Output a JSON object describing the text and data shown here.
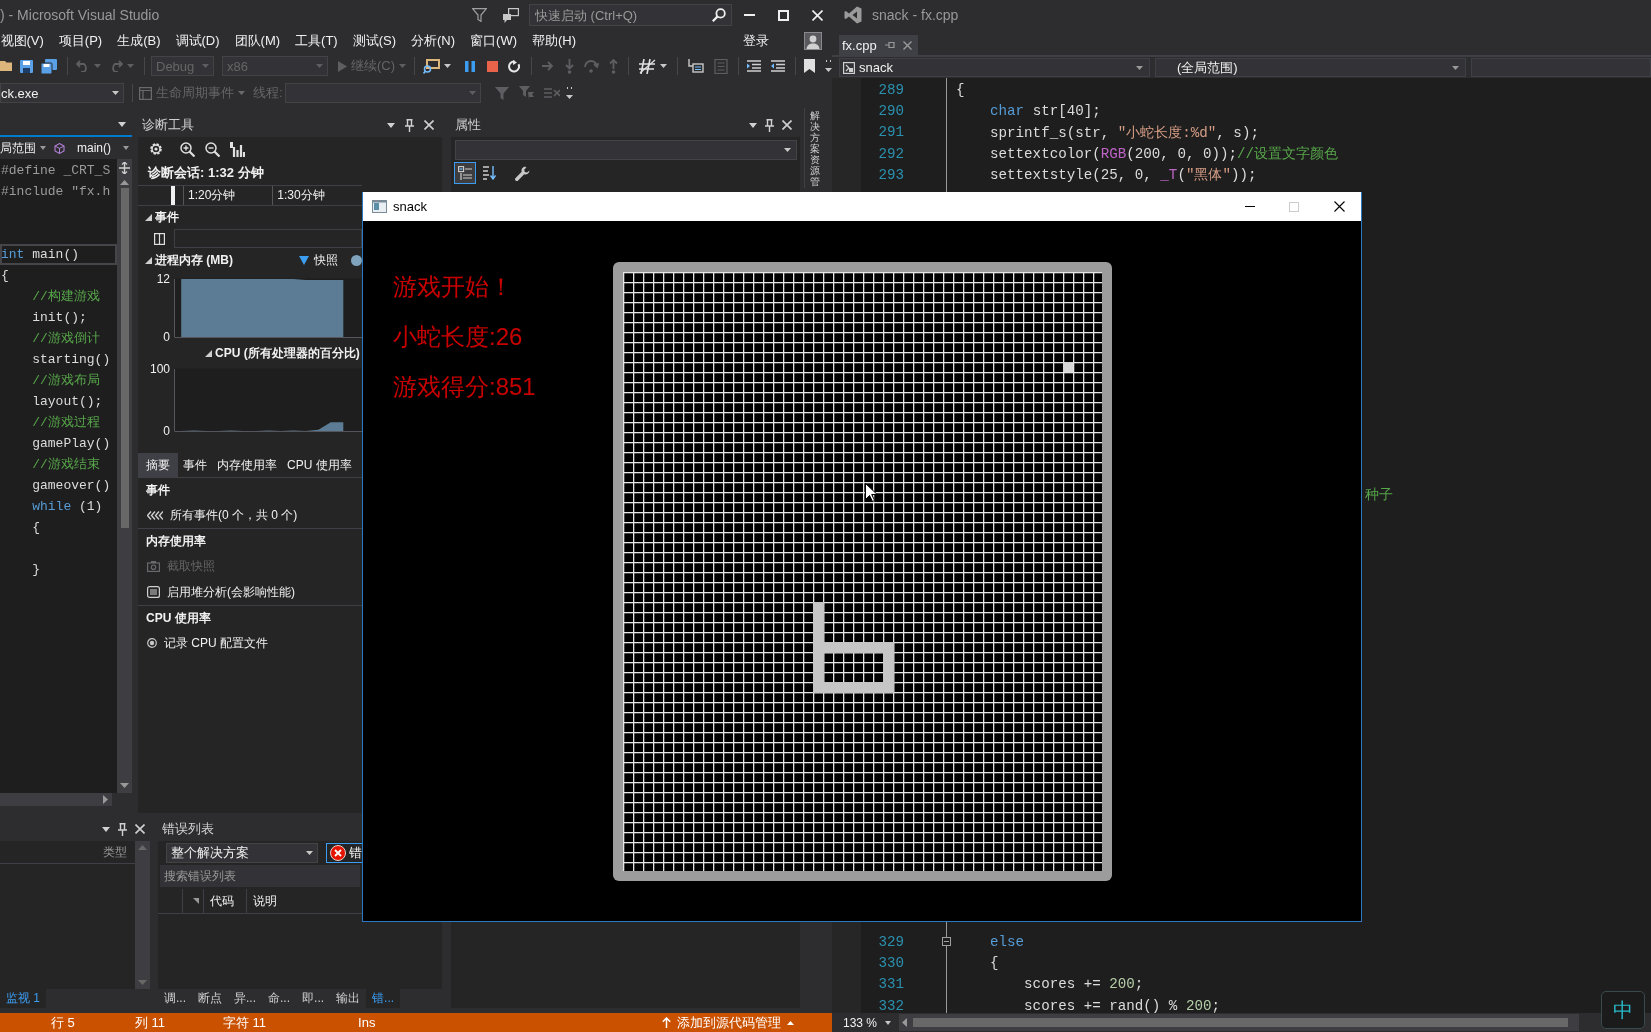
{
  "left_window": {
    "title": ") - Microsoft Visual Studio",
    "quick_launch": {
      "placeholder": "快速启动 (Ctrl+Q)"
    },
    "menu": [
      "视图(V)",
      "项目(P)",
      "生成(B)",
      "调试(D)",
      "团队(M)",
      "工具(T)",
      "测试(S)",
      "分析(N)",
      "窗口(W)",
      "帮助(H)"
    ],
    "sign_in": "登录",
    "toolbar": {
      "configuration": {
        "value": "Debug",
        "disabled": true
      },
      "platform": {
        "value": "x86",
        "disabled": true
      },
      "continue_button": {
        "label": "继续(C)",
        "disabled": true
      }
    },
    "debug_location": {
      "process": "ck.exe",
      "lifecycle_events": {
        "label": "生命周期事件",
        "disabled": true
      },
      "thread": {
        "label": "线程:",
        "disabled": true
      }
    },
    "code_editor": {
      "scope": "局范围",
      "member": "main()",
      "blocks": [
        [
          {
            "current": false,
            "tokens": [
              {
                "kind": "preprocessor",
                "text": "#define _CRT_S"
              }
            ]
          },
          {
            "current": false,
            "tokens": [
              {
                "kind": "preprocessor",
                "text": "#include \"fx.h"
              }
            ]
          }
        ],
        [
          {
            "current": true,
            "tokens": [
              {
                "kind": "keyword",
                "text": "int"
              },
              {
                "kind": "plain",
                "text": " main()"
              }
            ]
          },
          {
            "current": false,
            "tokens": [
              {
                "kind": "plain",
                "text": "{"
              }
            ]
          },
          {
            "current": false,
            "tokens": [
              {
                "kind": "comment",
                "text": "    //构建游戏"
              }
            ]
          },
          {
            "current": false,
            "tokens": [
              {
                "kind": "plain",
                "text": "    init();"
              }
            ]
          },
          {
            "current": false,
            "tokens": [
              {
                "kind": "comment",
                "text": "    //游戏倒计"
              }
            ]
          },
          {
            "current": false,
            "tokens": [
              {
                "kind": "plain",
                "text": "    starting()"
              }
            ]
          },
          {
            "current": false,
            "tokens": [
              {
                "kind": "comment",
                "text": "    //游戏布局"
              }
            ]
          },
          {
            "current": false,
            "tokens": [
              {
                "kind": "plain",
                "text": "    layout();"
              }
            ]
          },
          {
            "current": false,
            "tokens": [
              {
                "kind": "comment",
                "text": "    //游戏过程"
              }
            ]
          },
          {
            "current": false,
            "tokens": [
              {
                "kind": "plain",
                "text": "    gamePlay()"
              }
            ]
          },
          {
            "current": false,
            "tokens": [
              {
                "kind": "comment",
                "text": "    //游戏结束"
              }
            ]
          },
          {
            "current": false,
            "tokens": [
              {
                "kind": "plain",
                "text": "    gameover()"
              }
            ]
          },
          {
            "current": false,
            "tokens": [
              {
                "kind": "keyword",
                "text": "    while"
              },
              {
                "kind": "plain",
                "text": " (1)"
              }
            ]
          },
          {
            "current": false,
            "tokens": [
              {
                "kind": "plain",
                "text": "    {"
              }
            ]
          }
        ],
        [
          {
            "current": false,
            "tokens": [
              {
                "kind": "plain",
                "text": "    }"
              }
            ]
          }
        ]
      ]
    },
    "diagnostic_tools": {
      "title": "诊断工具",
      "session": "诊断会话: 1:32 分钟",
      "timeline": [
        "1:20分钟",
        "1:30分钟"
      ],
      "events_section": {
        "title": "事件",
        "expanded": true
      },
      "memory_section": {
        "title": "进程内存 (MB)",
        "expanded": true,
        "legend": "快照",
        "chart_data": {
          "type": "area",
          "categories": [
            null,
            null,
            null,
            null,
            null,
            null,
            null,
            null,
            null,
            null,
            null,
            null,
            null,
            null,
            null
          ],
          "yticks": [
            0,
            12
          ],
          "ylim": [
            0,
            12
          ],
          "values": [
            12,
            12,
            12,
            12,
            12,
            12,
            12,
            12,
            12,
            12,
            11.8,
            11.8,
            11.8,
            11.8,
            null
          ]
        }
      },
      "cpu_section": {
        "title": "CPU (所有处理器的百分比)",
        "expanded": true,
        "chart_data": {
          "type": "area",
          "categories": [
            null,
            null,
            null,
            null,
            null,
            null,
            null,
            null,
            null,
            null,
            null,
            null,
            null,
            null,
            null
          ],
          "yticks": [
            0,
            100
          ],
          "ylim": [
            0,
            100
          ],
          "values": [
            0,
            1,
            0,
            0,
            1,
            0,
            0,
            1,
            0,
            1,
            0,
            2,
            14,
            14,
            null
          ]
        }
      },
      "tabs": [
        {
          "label": "摘要",
          "selected": true
        },
        {
          "label": "事件",
          "selected": false
        },
        {
          "label": "内存使用率",
          "selected": false
        },
        {
          "label": "CPU 使用率",
          "selected": false
        }
      ],
      "summary": [
        {
          "title": "事件",
          "items": [
            {
              "kind": "events",
              "label": "所有事件(0 个，共 0 个)",
              "disabled": false
            }
          ]
        },
        {
          "title": "内存使用率",
          "items": [
            {
              "kind": "snapshot",
              "label": "截取快照",
              "disabled": true
            },
            {
              "kind": "heap",
              "label": "启用堆分析(会影响性能)",
              "disabled": false
            }
          ]
        },
        {
          "title": "CPU 使用率",
          "items": [
            {
              "kind": "record",
              "label": "记录 CPU 配置文件",
              "disabled": false
            }
          ]
        }
      ]
    },
    "properties": {
      "title": "属性",
      "view_buttons": [
        {
          "selected": true
        },
        {
          "selected": false
        }
      ]
    },
    "side_tab": "解决方案资源管",
    "watch": {
      "column": "类型",
      "tabs": [
        {
          "label": "监视 1",
          "selected": true
        }
      ]
    },
    "error_list": {
      "title": "错误列表",
      "scope": "整个解决方案",
      "errors_button": "错",
      "search": {
        "placeholder": "搜索错误列表"
      },
      "columns": [
        "代码",
        "说明"
      ],
      "tabs": [
        {
          "label": "调...",
          "selected": false
        },
        {
          "label": "断点",
          "selected": false
        },
        {
          "label": "异...",
          "selected": false
        },
        {
          "label": "命...",
          "selected": false
        },
        {
          "label": "即...",
          "selected": false
        },
        {
          "label": "输出",
          "selected": false
        },
        {
          "label": "错...",
          "selected": true
        }
      ]
    },
    "status_bar": {
      "line": "行 5",
      "column": "列 11",
      "character": "字符 11",
      "mode": "Ins",
      "source_control": "添加到源代码管理"
    }
  },
  "right_window": {
    "title": "snack - fx.cpp",
    "tabs": [
      {
        "label": "fx.cpp",
        "selected": true
      }
    ],
    "project": "snack",
    "scope": "(全局范围)",
    "code_top": [
      {
        "number": "289",
        "fold_marker": false,
        "tokens": [
          {
            "kind": "plain",
            "text": "{"
          }
        ]
      },
      {
        "number": "290",
        "fold_marker": false,
        "tokens": [
          {
            "kind": "keyword",
            "text": "    char"
          },
          {
            "kind": "plain",
            "text": " str[40];"
          }
        ]
      },
      {
        "number": "291",
        "fold_marker": false,
        "tokens": [
          {
            "kind": "plain",
            "text": "    sprintf_s(str, "
          },
          {
            "kind": "string",
            "text": "\"小蛇长度:%d\""
          },
          {
            "kind": "plain",
            "text": ", s);"
          }
        ]
      },
      {
        "number": "292",
        "fold_marker": false,
        "tokens": [
          {
            "kind": "plain",
            "text": "    settextcolor("
          },
          {
            "kind": "macro",
            "text": "RGB"
          },
          {
            "kind": "plain",
            "text": "(200, 0, 0));"
          },
          {
            "kind": "comment",
            "text": "//设置文字颜色"
          }
        ]
      },
      {
        "number": "293",
        "fold_marker": false,
        "tokens": [
          {
            "kind": "plain",
            "text": "    settextstyle(25, 0, "
          },
          {
            "kind": "macro",
            "text": "_T"
          },
          {
            "kind": "plain",
            "text": "("
          },
          {
            "kind": "string",
            "text": "\"黑体\""
          },
          {
            "kind": "plain",
            "text": "));"
          }
        ]
      }
    ],
    "comment_fragment": "种子",
    "code_bottom": [
      {
        "number": "329",
        "fold_marker": true,
        "tokens": [
          {
            "kind": "keyword",
            "text": "    else"
          }
        ]
      },
      {
        "number": "330",
        "fold_marker": false,
        "tokens": [
          {
            "kind": "plain",
            "text": "    {"
          }
        ]
      },
      {
        "number": "331",
        "fold_marker": false,
        "tokens": [
          {
            "kind": "plain",
            "text": "        scores += "
          },
          {
            "kind": "number",
            "text": "200"
          },
          {
            "kind": "plain",
            "text": ";"
          }
        ]
      },
      {
        "number": "332",
        "fold_marker": false,
        "tokens": [
          {
            "kind": "plain",
            "text": "        scores += rand() % "
          },
          {
            "kind": "number",
            "text": "200"
          },
          {
            "kind": "plain",
            "text": ";"
          }
        ]
      }
    ],
    "zoom": "133 %"
  },
  "game_window": {
    "title": "snack",
    "maximize_disabled": true,
    "texts": [
      "游戏开始！",
      "小蛇长度:26",
      "游戏得分:851"
    ]
  },
  "ime_indicator": "中"
}
